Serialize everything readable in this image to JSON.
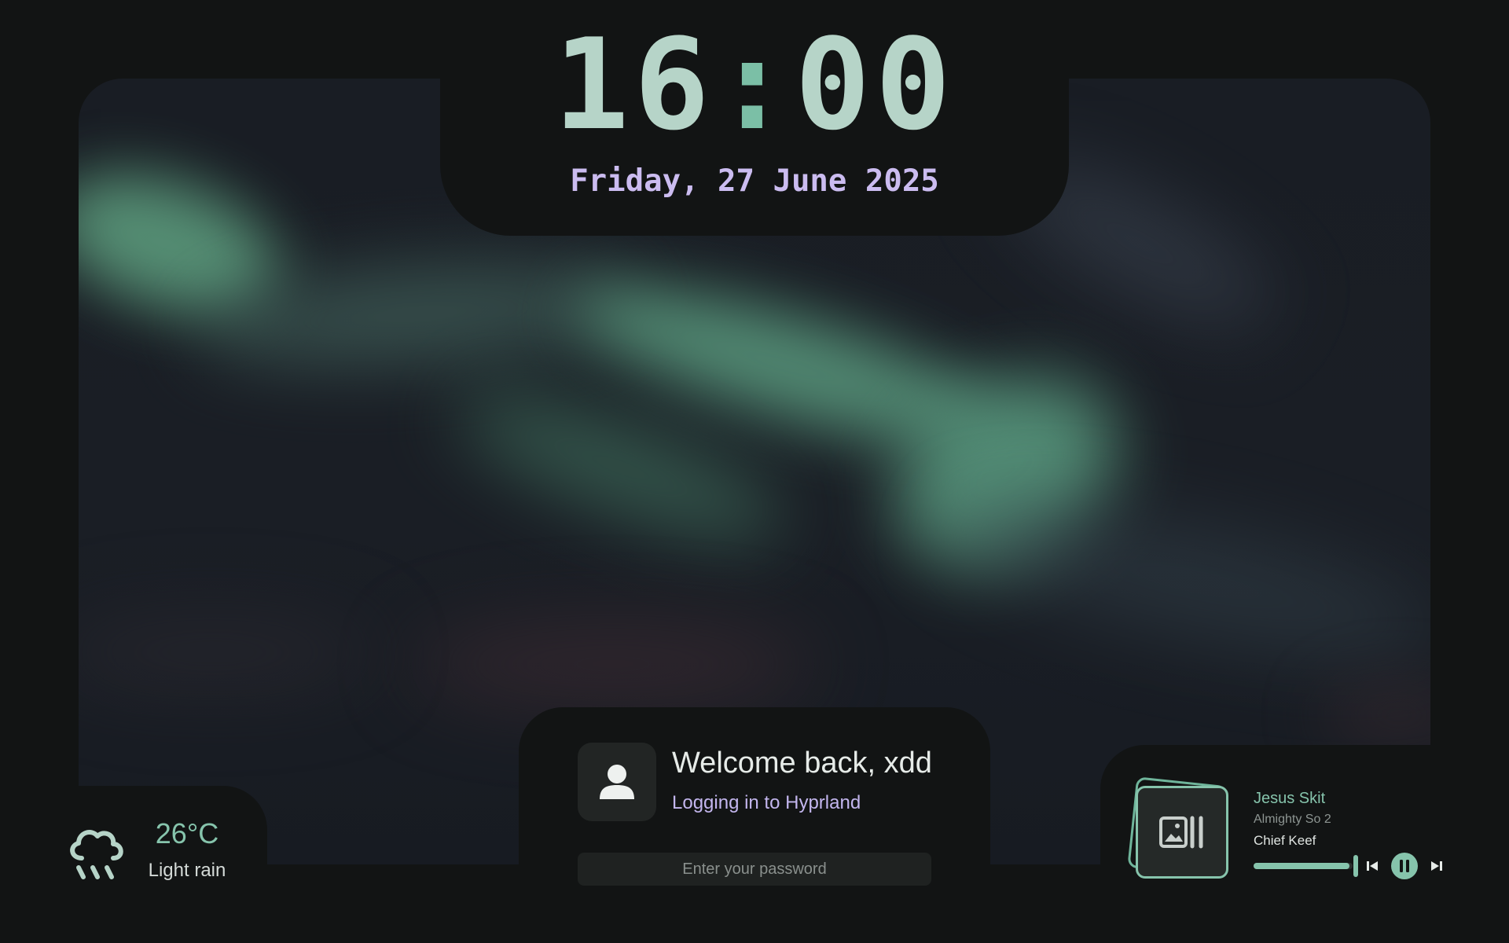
{
  "clock": {
    "hours": "16",
    "separator": ":",
    "minutes": "00"
  },
  "date": "Friday, 27 June 2025",
  "weather": {
    "icon": "rain-cloud-icon",
    "temperature": "26°C",
    "condition": "Light rain"
  },
  "login": {
    "welcome": "Welcome back, xdd",
    "subtitle": "Logging in to Hyprland",
    "password_placeholder": "Enter your password",
    "avatar_icon": "user-icon"
  },
  "media": {
    "title": "Jesus Skit",
    "album": "Almighty So 2",
    "artist": "Chief Keef",
    "progress": 0.97,
    "art_icon": "album-art-placeholder-icon",
    "controls": {
      "previous": "skip-previous-icon",
      "play_pause": "pause-icon",
      "next": "skip-next-icon"
    }
  },
  "colors": {
    "background": "#121414",
    "accent": "#86c4ac",
    "clock": "#b6d4c8",
    "lavender": "#c3b6ee"
  }
}
